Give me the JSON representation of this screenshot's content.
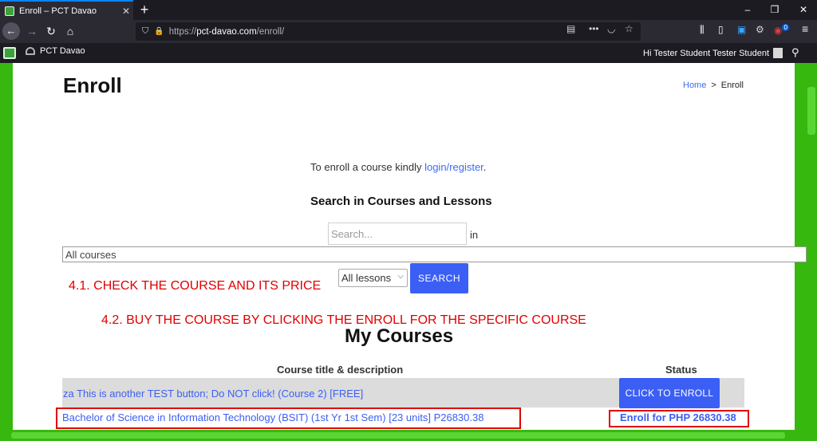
{
  "browser": {
    "tab_title": "Enroll – PCT Davao",
    "tab_close": "✕",
    "new_tab": "+",
    "url_scheme": "https://",
    "url_host": "pct-davao.com",
    "url_path": "/enroll/",
    "bookmark_label": "PCT Davao",
    "greeting": "Hi Tester Student Tester Student",
    "window_minimize": "–",
    "window_restore": "❐",
    "window_close": "✕",
    "extension_badge": "0",
    "menu_icon": "≡"
  },
  "page": {
    "title": "Enroll",
    "breadcrumb": {
      "home": "Home",
      "separator": ">",
      "current": "Enroll"
    },
    "login_message": {
      "prefix": "To enroll a course kindly ",
      "link": "login/register",
      "suffix": "."
    },
    "search": {
      "heading": "Search in Courses and Lessons",
      "placeholder": "Search...",
      "in_label": "in",
      "courses_select": "All courses",
      "lessons_select": "All lessons",
      "button": "SEARCH"
    },
    "annotations": {
      "step1": "4.1. CHECK THE COURSE AND ITS PRICE",
      "step2": "4.2. BUY THE COURSE BY CLICKING THE ENROLL FOR  THE SPECIFIC COURSE"
    },
    "my_courses": {
      "heading": "My Courses",
      "columns": [
        "Course title & description",
        "Status"
      ],
      "rows": [
        {
          "title": "za This is another TEST button; Do NOT click! (Course 2) [FREE]",
          "status": "CLICK TO ENROLL"
        },
        {
          "title": "Bachelor of Science in Information Technology (BSIT) (1st Yr 1st Sem) [23 units] P26830.38",
          "status": "Enroll for PHP 26830.38"
        }
      ]
    }
  },
  "colors": {
    "accent": "#3b5ff5",
    "annotation": "#e00000",
    "frame": "#37b80f"
  }
}
